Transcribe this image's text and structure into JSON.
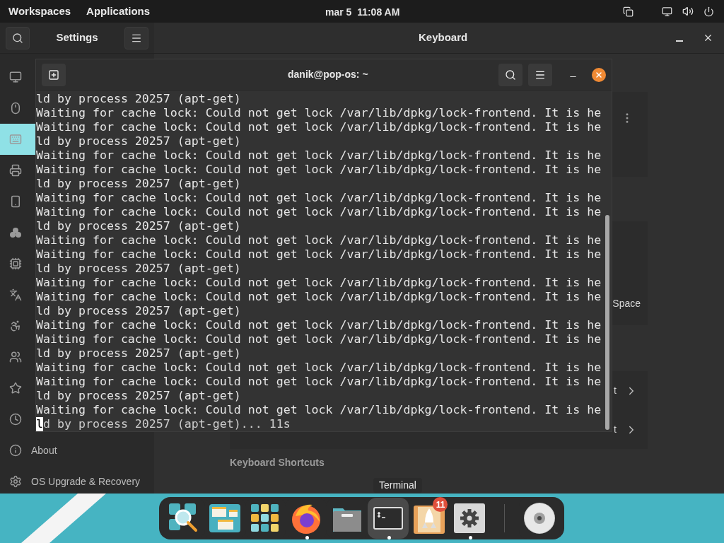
{
  "top_bar": {
    "menus": [
      "Workspaces",
      "Applications"
    ],
    "clock": "mar 5  11:08 AM"
  },
  "settings": {
    "title": "Settings",
    "page_title": "Keyboard",
    "sidebar": [
      {
        "kind": "display",
        "selected": false
      },
      {
        "kind": "mouse",
        "selected": false
      },
      {
        "kind": "keyboard",
        "selected": true
      },
      {
        "kind": "printer",
        "selected": false
      },
      {
        "kind": "removable",
        "selected": false
      },
      {
        "kind": "color",
        "selected": false
      },
      {
        "kind": "firmware",
        "selected": false
      },
      {
        "kind": "region",
        "selected": false
      },
      {
        "kind": "accessibility",
        "selected": false
      },
      {
        "kind": "users",
        "selected": false
      },
      {
        "kind": "default-apps",
        "selected": false
      },
      {
        "kind": "date-time",
        "selected": false
      },
      {
        "label": "About",
        "kind": "about",
        "selected": false
      },
      {
        "label": "OS Upgrade & Recovery",
        "kind": "upgrade",
        "selected": false
      }
    ],
    "content": {
      "space_label": "Space",
      "row_labels": [
        "t",
        "t"
      ],
      "section_heading": "Keyboard Shortcuts"
    }
  },
  "terminal": {
    "title": "danik@pop-os: ~",
    "cursor_on_last_line": true,
    "lines": [
      "ld by process 20257 (apt-get)",
      "Waiting for cache lock: Could not get lock /var/lib/dpkg/lock-frontend. It is he",
      "Waiting for cache lock: Could not get lock /var/lib/dpkg/lock-frontend. It is he",
      "ld by process 20257 (apt-get)",
      "Waiting for cache lock: Could not get lock /var/lib/dpkg/lock-frontend. It is he",
      "Waiting for cache lock: Could not get lock /var/lib/dpkg/lock-frontend. It is he",
      "ld by process 20257 (apt-get)",
      "Waiting for cache lock: Could not get lock /var/lib/dpkg/lock-frontend. It is he",
      "Waiting for cache lock: Could not get lock /var/lib/dpkg/lock-frontend. It is he",
      "ld by process 20257 (apt-get)",
      "Waiting for cache lock: Could not get lock /var/lib/dpkg/lock-frontend. It is he",
      "Waiting for cache lock: Could not get lock /var/lib/dpkg/lock-frontend. It is he",
      "ld by process 20257 (apt-get)",
      "Waiting for cache lock: Could not get lock /var/lib/dpkg/lock-frontend. It is he",
      "Waiting for cache lock: Could not get lock /var/lib/dpkg/lock-frontend. It is he",
      "ld by process 20257 (apt-get)",
      "Waiting for cache lock: Could not get lock /var/lib/dpkg/lock-frontend. It is he",
      "Waiting for cache lock: Could not get lock /var/lib/dpkg/lock-frontend. It is he",
      "ld by process 20257 (apt-get)",
      "Waiting for cache lock: Could not get lock /var/lib/dpkg/lock-frontend. It is he",
      "Waiting for cache lock: Could not get lock /var/lib/dpkg/lock-frontend. It is he",
      "ld by process 20257 (apt-get)",
      "Waiting for cache lock: Could not get lock /var/lib/dpkg/lock-frontend. It is he",
      "ld by process 20257 (apt-get)... 11s"
    ]
  },
  "dock": {
    "tooltip": "Terminal",
    "items": [
      {
        "kind": "search",
        "running": false,
        "selected": false
      },
      {
        "kind": "workspaces",
        "running": false,
        "selected": false
      },
      {
        "kind": "apps",
        "running": false,
        "selected": false
      },
      {
        "kind": "browser",
        "running": true,
        "selected": false
      },
      {
        "kind": "files",
        "running": false,
        "selected": false
      },
      {
        "kind": "terminal",
        "running": true,
        "selected": true
      },
      {
        "kind": "shop",
        "running": false,
        "selected": false,
        "badge": "11"
      },
      {
        "kind": "settings",
        "running": true,
        "selected": false
      },
      {
        "kind": "separator"
      },
      {
        "kind": "disc",
        "running": false,
        "selected": false
      }
    ]
  }
}
